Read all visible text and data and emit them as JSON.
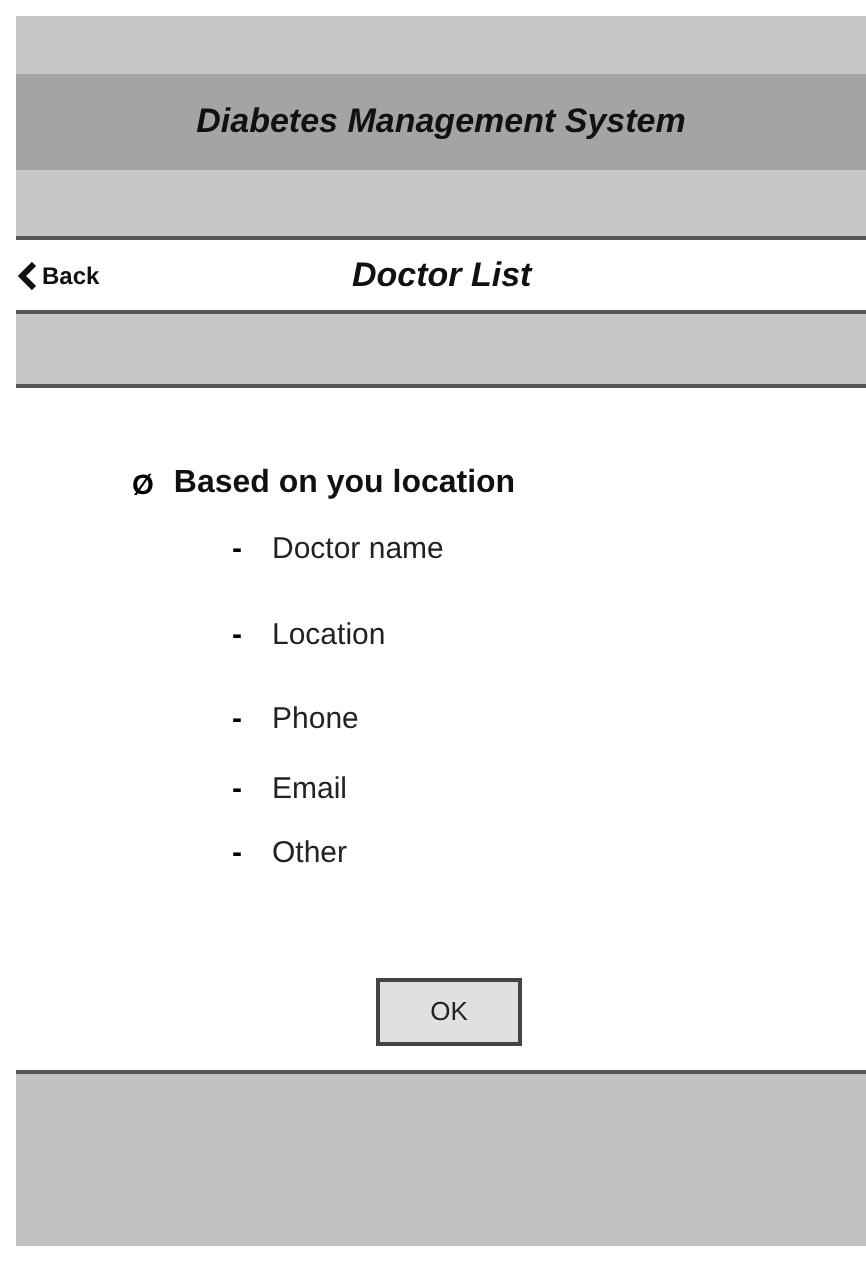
{
  "app_title": "Diabetes Management System",
  "nav": {
    "back": "Back",
    "title": "Doctor List"
  },
  "section": {
    "bullet": "Ø",
    "heading": "Based on you location",
    "items": [
      {
        "dash": "-",
        "label": "Doctor name"
      },
      {
        "dash": "-",
        "label": "Location"
      },
      {
        "dash": "-",
        "label": "Phone"
      },
      {
        "dash": "-",
        "label": "Email"
      },
      {
        "dash": "-",
        "label": "Other"
      }
    ]
  },
  "buttons": [
    "OK"
  ]
}
